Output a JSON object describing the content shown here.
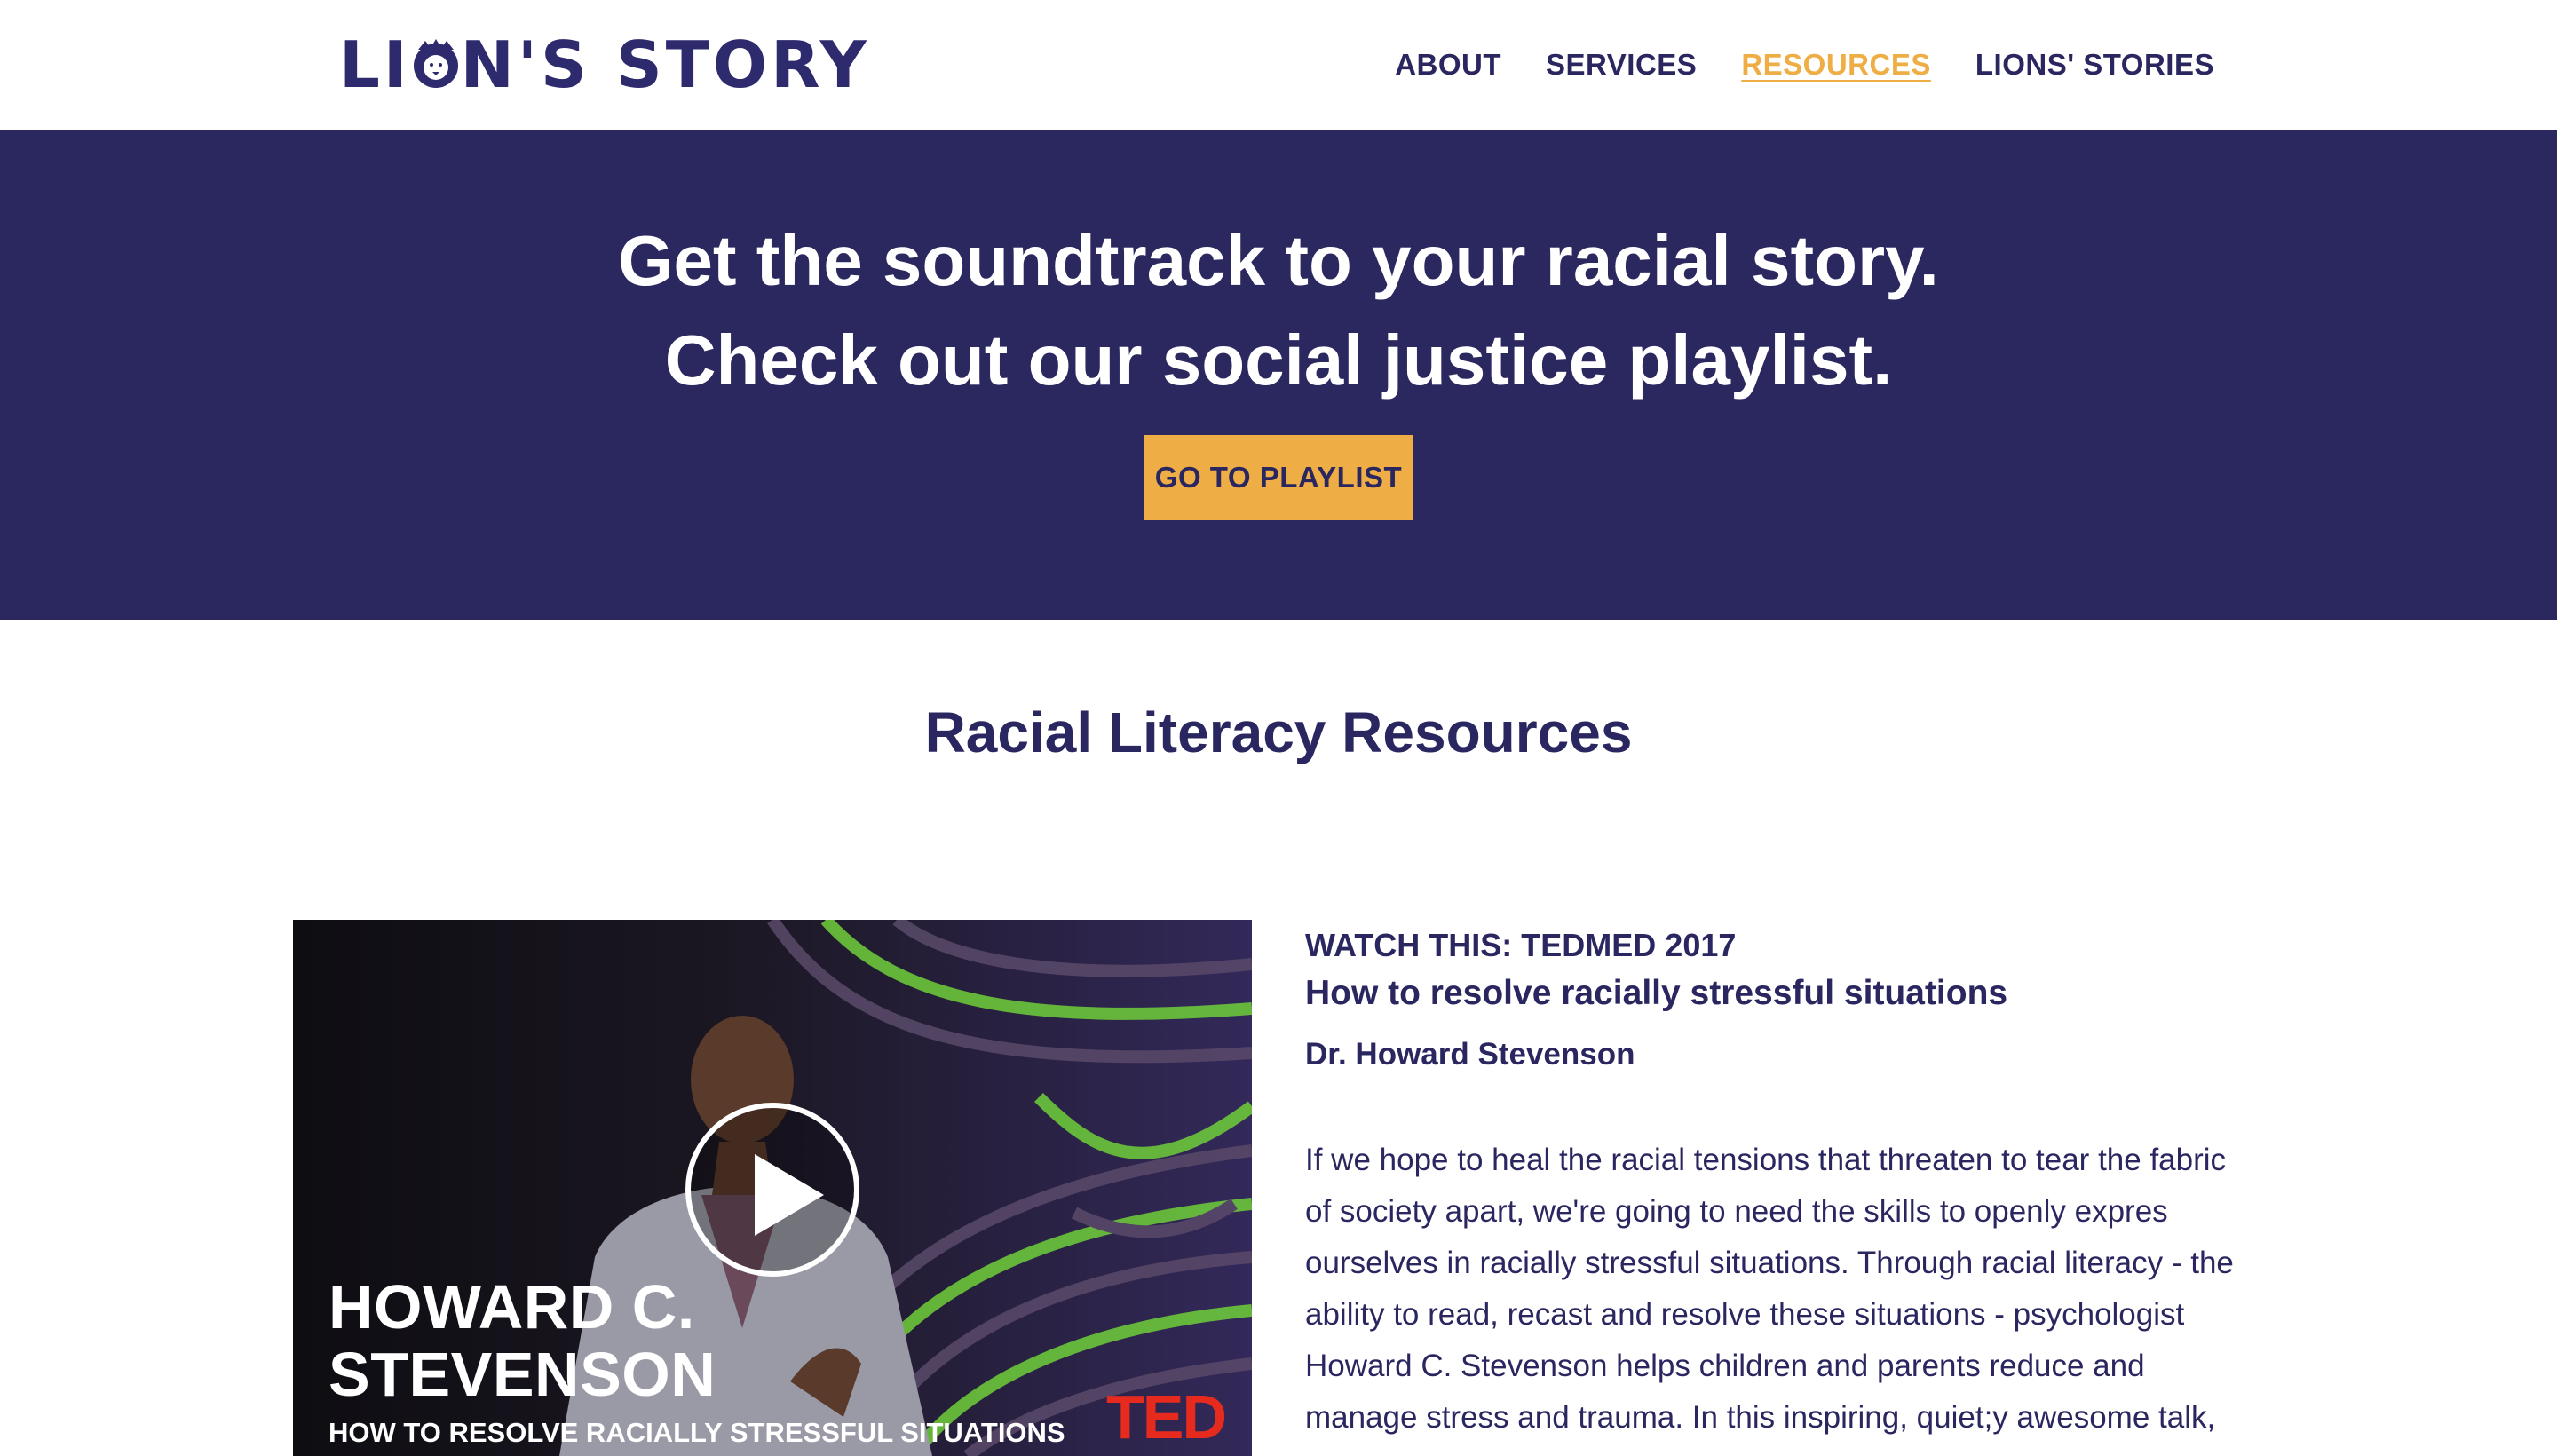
{
  "header": {
    "logo_text_left": "LI",
    "logo_text_right": "N'S STORY",
    "logo_alt": "LION'S STORY",
    "nav": [
      {
        "label": "ABOUT",
        "active": false
      },
      {
        "label": "SERVICES",
        "active": false
      },
      {
        "label": "RESOURCES",
        "active": true
      },
      {
        "label": "LIONS' STORIES",
        "active": false
      }
    ]
  },
  "hero": {
    "line1": "Get the soundtrack to your racial story.",
    "line2": "Check out our social justice playlist.",
    "button_label": "GO TO PLAYLIST"
  },
  "section": {
    "title": "Racial Literacy Resources"
  },
  "video": {
    "speaker_name": "HOWARD C.\nSTEVENSON",
    "talk_caption": "HOW TO RESOLVE RACIALLY STRESSFUL SITUATIONS",
    "brand": "TED"
  },
  "resource": {
    "eyebrow": "WATCH THIS: TEDMED 2017",
    "title": "How to resolve racially stressful situations",
    "speaker": "Dr. Howard Stevenson",
    "description": "If we hope to heal the racial tensions that threaten to tear the fabric of society apart, we're going to need the skills to openly expres ourselves in racially stressful situations. Through racial literacy - the ability to read, recast and resolve these situations - psychologist Howard C. Stevenson helps children and parents reduce and manage stress and trauma. In this inspiring, quiet;y awesome talk,"
  },
  "colors": {
    "navy": "#2b2860",
    "accent": "#eeae45",
    "ted_red": "#e62b1e"
  }
}
